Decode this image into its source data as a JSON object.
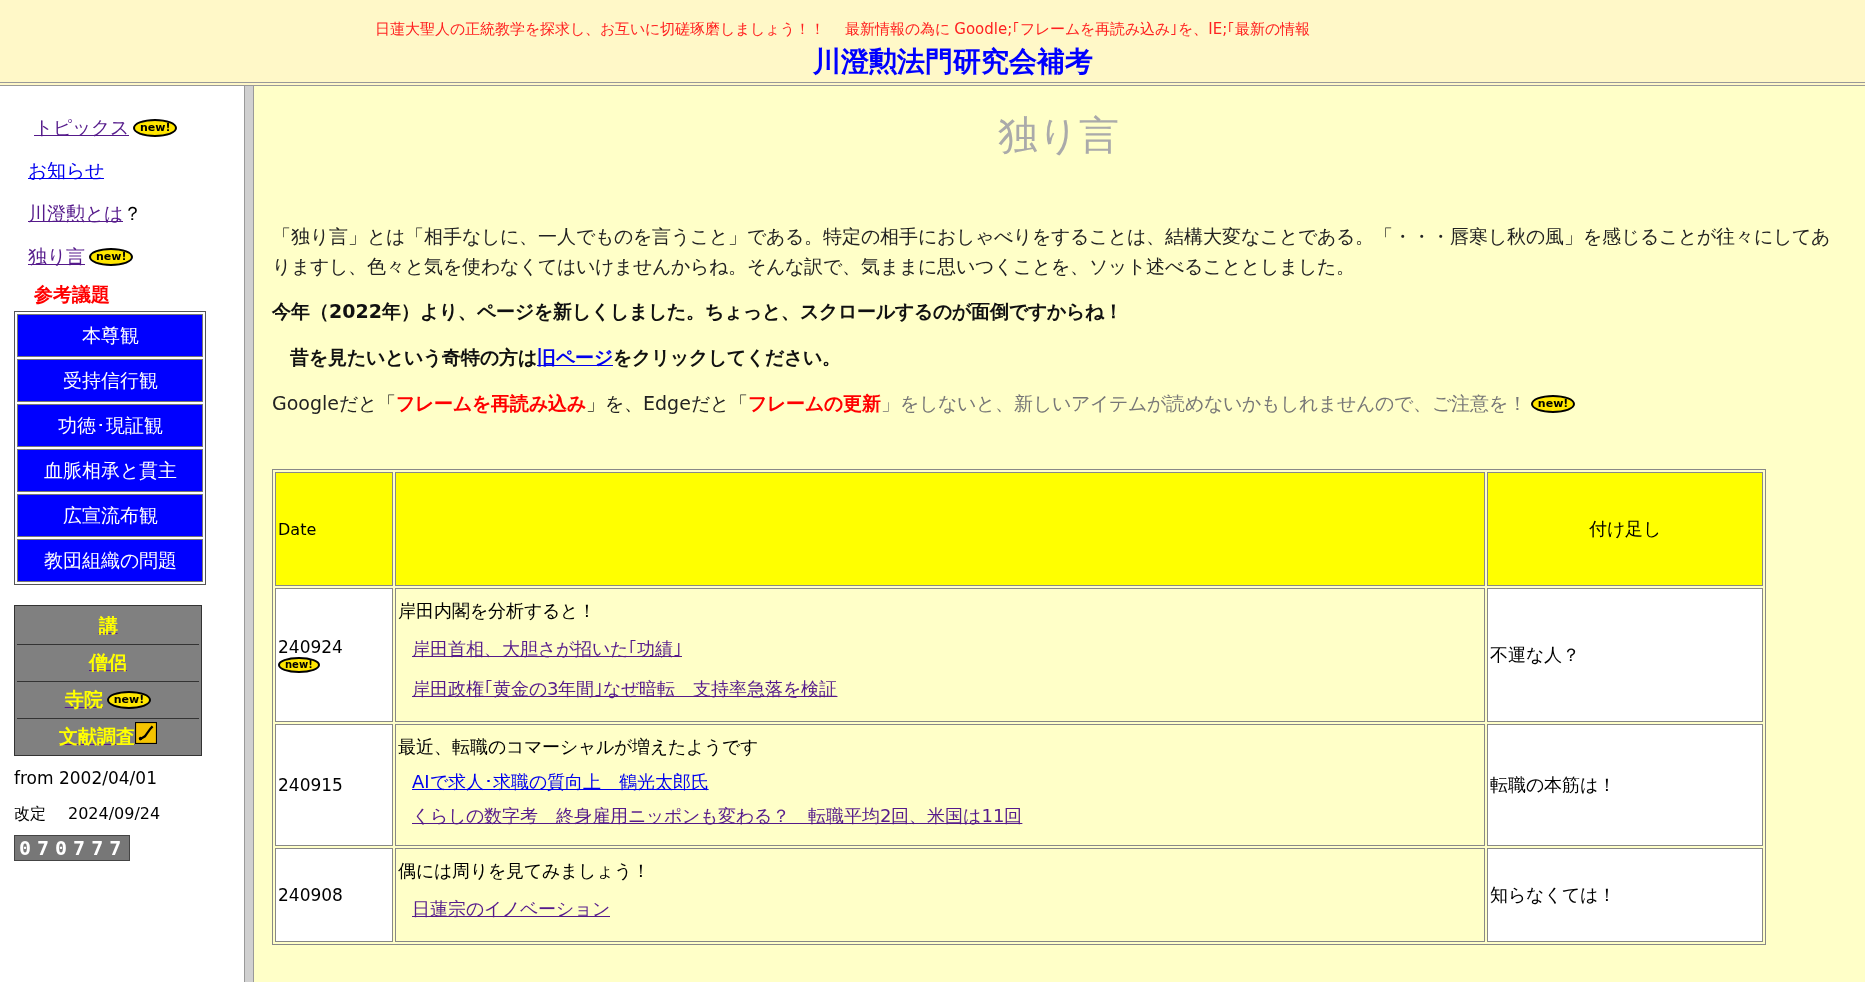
{
  "header": {
    "notice": "日蓮大聖人の正統教学を探求し、お互いに切磋琢磨しましょう！！　 最新情報の為に Goodle;｢フレームを再読み込み｣を、IE;｢最新の情報",
    "title": "川澄勲法門研究会補考"
  },
  "sidebar": {
    "links": [
      {
        "text": "トピックス",
        "visited": true,
        "badge": "new!"
      },
      {
        "text": "お知らせ",
        "visited": false
      },
      {
        "text": "川澄勲とは",
        "visited": true,
        "suffix": "？"
      },
      {
        "text": "独り言 ",
        "visited": true,
        "badge": "new!"
      }
    ],
    "section_title": "参考議題",
    "topics": [
      "本尊観",
      "受持信行観",
      "功徳･現証観",
      "血脈相承と貫主",
      "広宣流布観",
      "教団組織の問題"
    ],
    "sub_links": [
      {
        "text": "講"
      },
      {
        "text": "僧侶"
      },
      {
        "text": "寺院",
        "badge": "new!"
      },
      {
        "text": "文献調査",
        "icon": true
      }
    ],
    "since": "from 2002/04/01",
    "revised_label": "改定",
    "revised_date": "2024/09/24",
    "counter": "070777"
  },
  "main": {
    "title": "独り言",
    "intro": "「独り言」とは「相手なしに、一人でものを言うこと」である。特定の相手におしゃべりをすることは、結構大変なことである。「・・・唇寒し秋の風」を感じることが往々にしてありますし、色々と気を使わなくてはいけませんからね。そんな訳で、気ままに思いつくことを、ソット述べることとしました。",
    "notice": "今年（2022年）より、ページを新しくしました。ちょっと、スクロールするのが面倒ですからね！",
    "old_page": {
      "before": "昔を見たいという奇特の方は",
      "link": "旧ページ",
      "after": "をクリックしてください。"
    },
    "reload_note": {
      "segments": [
        {
          "kind": "plain",
          "text": "Googleだと「"
        },
        {
          "kind": "red",
          "text": "フレームを再読み込み"
        },
        {
          "kind": "plain",
          "text": "」を、Edgeだと「"
        },
        {
          "kind": "red",
          "text": "フレームの更新"
        },
        {
          "kind": "gray",
          "text": "」をしないと、新しいアイテムが読めないかもしれませんので、ご注意を！"
        }
      ],
      "badge": "new!"
    },
    "table": {
      "columns": [
        "Date",
        "",
        "付け足し"
      ],
      "rows": [
        {
          "date": "240924",
          "badge": "new!",
          "title": "岸田内閣を分析すると！",
          "links": [
            {
              "text": "岸田首相、大胆さが招いた｢功績｣",
              "visited": true
            },
            {
              "text": "岸田政権｢黄金の3年間｣なぜ暗転　支持率急落を検証",
              "visited": true
            }
          ],
          "note": "不運な人？"
        },
        {
          "date": "240915",
          "title": "最近、転職のコマーシャルが増えたようです",
          "links": [
            {
              "text": "AIで求人･求職の質向上　鶴光太郎氏",
              "visited": false
            },
            {
              "text": "くらしの数字考　終身雇用ニッポンも変わる？　転職平均2回、米国は11回",
              "visited": true
            }
          ],
          "note": "転職の本筋は！"
        },
        {
          "date": "240908",
          "title": "偶には周りを見てみましょう！",
          "links": [
            {
              "text": "日蓮宗のイノベーション",
              "visited": true
            }
          ],
          "note": "知らなくては！"
        }
      ]
    }
  }
}
